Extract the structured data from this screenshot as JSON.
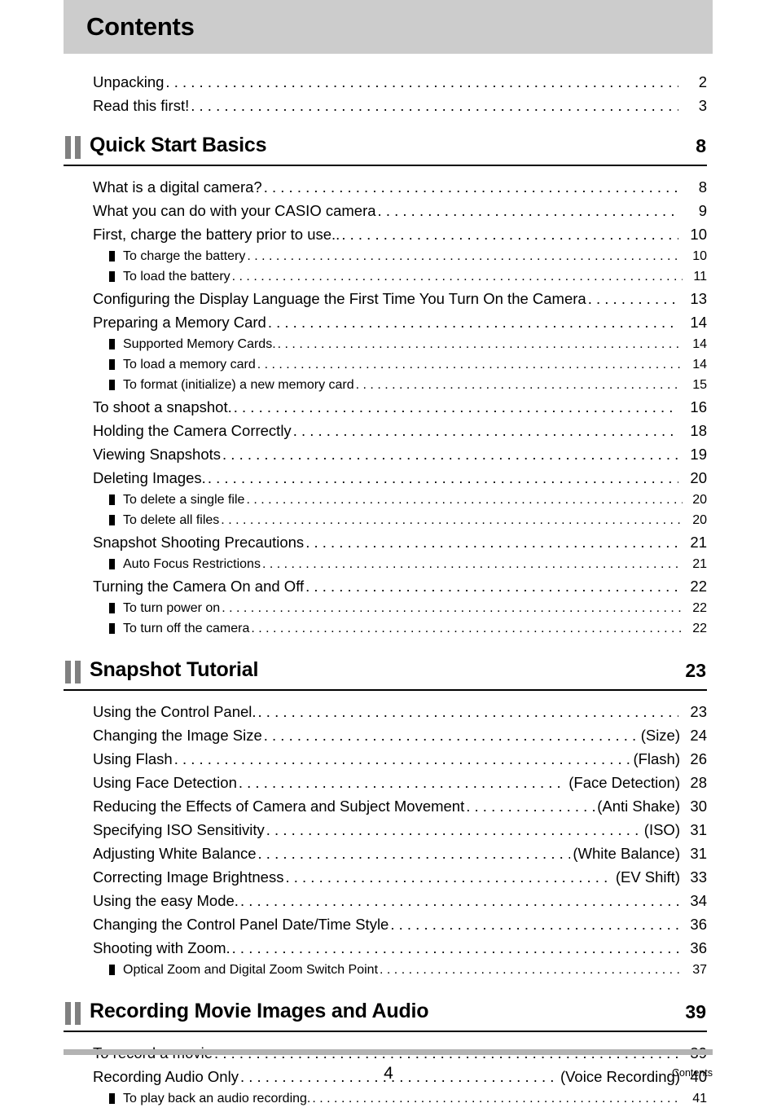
{
  "header": {
    "title": "Contents"
  },
  "intro": {
    "entries": [
      {
        "label": "Unpacking",
        "aux": "",
        "page": "2"
      },
      {
        "label": "Read this first!",
        "aux": "",
        "page": "3"
      }
    ]
  },
  "sections": [
    {
      "icon": "double-bar-icon",
      "title": "Quick Start Basics",
      "page": "8",
      "entries": [
        {
          "level": 1,
          "label": "What is a digital camera?",
          "aux": "",
          "page": "8"
        },
        {
          "level": 1,
          "label": "What you can do with your CASIO camera",
          "aux": "",
          "page": "9"
        },
        {
          "level": 1,
          "label": "First, charge the battery prior to use..",
          "aux": "",
          "page": "10"
        },
        {
          "level": 2,
          "label": "To charge the battery",
          "aux": "",
          "page": "10"
        },
        {
          "level": 2,
          "label": "To load the battery",
          "aux": "",
          "page": "11"
        },
        {
          "level": 1,
          "label": "Configuring the Display Language the First Time You Turn On the Camera",
          "aux": "",
          "page": "13"
        },
        {
          "level": 1,
          "label": "Preparing a Memory Card",
          "aux": "",
          "page": "14"
        },
        {
          "level": 2,
          "label": "Supported Memory Cards.",
          "aux": "",
          "page": "14"
        },
        {
          "level": 2,
          "label": "To load a memory card",
          "aux": "",
          "page": "14"
        },
        {
          "level": 2,
          "label": "To format (initialize) a new memory card",
          "aux": "",
          "page": "15"
        },
        {
          "level": 1,
          "label": "To shoot a snapshot.",
          "aux": "",
          "page": "16"
        },
        {
          "level": 1,
          "label": "Holding the Camera Correctly",
          "aux": "",
          "page": "18"
        },
        {
          "level": 1,
          "label": "Viewing Snapshots",
          "aux": "",
          "page": "19"
        },
        {
          "level": 1,
          "label": "Deleting Images.",
          "aux": "",
          "page": "20"
        },
        {
          "level": 2,
          "label": "To delete a single file",
          "aux": "",
          "page": "20"
        },
        {
          "level": 2,
          "label": "To delete all files",
          "aux": "",
          "page": "20"
        },
        {
          "level": 1,
          "label": "Snapshot Shooting Precautions",
          "aux": "",
          "page": "21"
        },
        {
          "level": 2,
          "label": "Auto Focus Restrictions",
          "aux": "",
          "page": "21"
        },
        {
          "level": 1,
          "label": "Turning the Camera On and Off",
          "aux": "",
          "page": "22"
        },
        {
          "level": 2,
          "label": "To turn power on",
          "aux": "",
          "page": "22"
        },
        {
          "level": 2,
          "label": "To turn off the camera",
          "aux": "",
          "page": "22"
        }
      ]
    },
    {
      "icon": "double-bar-icon",
      "title": "Snapshot Tutorial",
      "page": "23",
      "entries": [
        {
          "level": 1,
          "label": "Using the Control Panel.",
          "aux": "",
          "page": "23"
        },
        {
          "level": 1,
          "label": "Changing the Image Size",
          "aux": "(Size)",
          "page": "24"
        },
        {
          "level": 1,
          "label": "Using Flash",
          "aux": "(Flash)",
          "page": "26"
        },
        {
          "level": 1,
          "label": "Using Face Detection",
          "aux": "(Face Detection)",
          "page": "28"
        },
        {
          "level": 1,
          "label": "Reducing the Effects of Camera and Subject Movement",
          "aux": "(Anti Shake)",
          "page": "30"
        },
        {
          "level": 1,
          "label": "Specifying ISO Sensitivity",
          "aux": "(ISO)",
          "page": "31"
        },
        {
          "level": 1,
          "label": "Adjusting White Balance",
          "aux": "(White Balance)",
          "page": "31"
        },
        {
          "level": 1,
          "label": "Correcting Image Brightness",
          "aux": "(EV Shift)",
          "page": "33"
        },
        {
          "level": 1,
          "label": "Using the easy Mode.",
          "aux": "",
          "page": "34"
        },
        {
          "level": 1,
          "label": "Changing the Control Panel Date/Time Style",
          "aux": "",
          "page": "36"
        },
        {
          "level": 1,
          "label": "Shooting with Zoom.",
          "aux": "",
          "page": "36"
        },
        {
          "level": 2,
          "label": "Optical Zoom and Digital Zoom Switch Point",
          "aux": "",
          "page": "37"
        }
      ]
    },
    {
      "icon": "double-bar-icon",
      "title": "Recording Movie Images and Audio",
      "page": "39",
      "entries": [
        {
          "level": 1,
          "label": "To record a movie",
          "aux": "",
          "page": "39"
        },
        {
          "level": 1,
          "label": "Recording Audio Only",
          "aux": "(Voice Recording)",
          "page": "40"
        },
        {
          "level": 2,
          "label": "To play back an audio recording.",
          "aux": "",
          "page": "41"
        }
      ]
    }
  ],
  "footer": {
    "page_number": "4",
    "label": "Contents"
  },
  "colors": {
    "header_band": "#cccccc",
    "section_icon": "#808080",
    "footer_rule": "#b3b3b3",
    "text": "#000000"
  }
}
